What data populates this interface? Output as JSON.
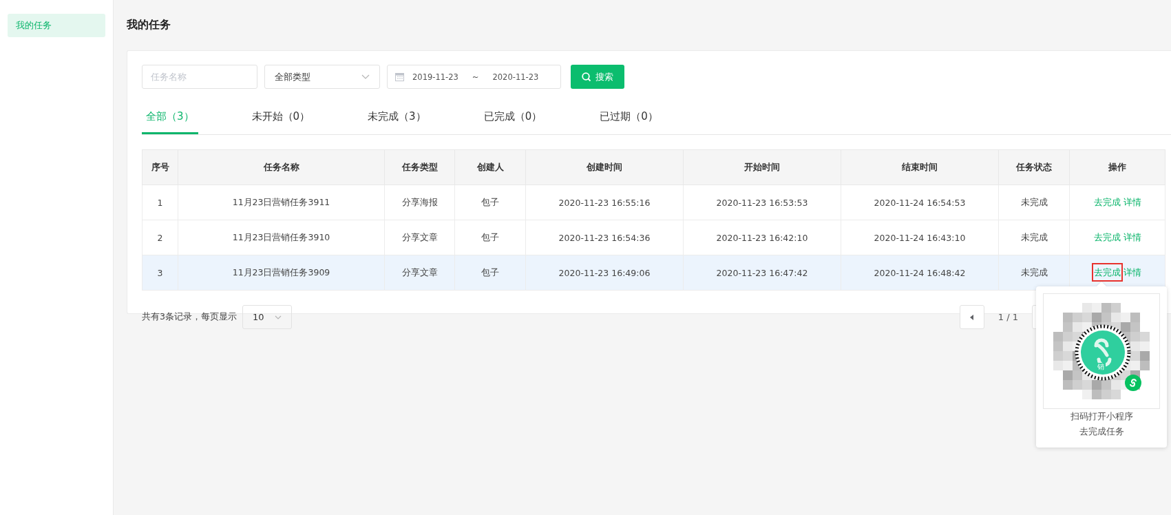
{
  "sidebar": {
    "items": [
      {
        "label": "我的任务",
        "selected": true
      }
    ]
  },
  "page": {
    "title": "我的任务"
  },
  "filters": {
    "name_placeholder": "任务名称",
    "type_value": "全部类型",
    "date_start": "2019-11-23",
    "date_sep": "~",
    "date_end": "2020-11-23",
    "search_label": "搜索"
  },
  "tabs": [
    {
      "label": "全部（3）",
      "selected": true
    },
    {
      "label": "未开始（0）",
      "selected": false
    },
    {
      "label": "未完成（3）",
      "selected": false
    },
    {
      "label": "已完成（0）",
      "selected": false
    },
    {
      "label": "已过期（0）",
      "selected": false
    }
  ],
  "table": {
    "columns": [
      "序号",
      "任务名称",
      "任务类型",
      "创建人",
      "创建时间",
      "开始时间",
      "结束时间",
      "任务状态",
      "操作"
    ],
    "rows": [
      {
        "selected": false,
        "cells": [
          "1",
          "11月23日营销任务3911",
          "分享海报",
          "包子",
          "2020-11-23 16:55:16",
          "2020-11-23 16:53:53",
          "2020-11-24 16:54:53",
          "未完成"
        ],
        "actions": [
          {
            "label": "去完成",
            "outlined": false
          },
          {
            "label": "详情",
            "outlined": false
          }
        ]
      },
      {
        "selected": false,
        "cells": [
          "2",
          "11月23日营销任务3910",
          "分享文章",
          "包子",
          "2020-11-23 16:54:36",
          "2020-11-23 16:42:10",
          "2020-11-24 16:43:10",
          "未完成"
        ],
        "actions": [
          {
            "label": "去完成",
            "outlined": false
          },
          {
            "label": "详情",
            "outlined": false
          }
        ]
      },
      {
        "selected": true,
        "cells": [
          "3",
          "11月23日营销任务3909",
          "分享文章",
          "包子",
          "2020-11-23 16:49:06",
          "2020-11-23 16:47:42",
          "2020-11-24 16:48:42",
          "未完成"
        ],
        "actions": [
          {
            "label": "去完成",
            "outlined": true
          },
          {
            "label": "详情",
            "outlined": false
          }
        ]
      }
    ]
  },
  "pagination": {
    "summary": "共有3条记录，每页显示",
    "page_size": "10",
    "page_info": "1 / 1"
  },
  "popup": {
    "logo_text": "销",
    "caption": "扫码打开小程序",
    "caption2": "去完成任务"
  }
}
